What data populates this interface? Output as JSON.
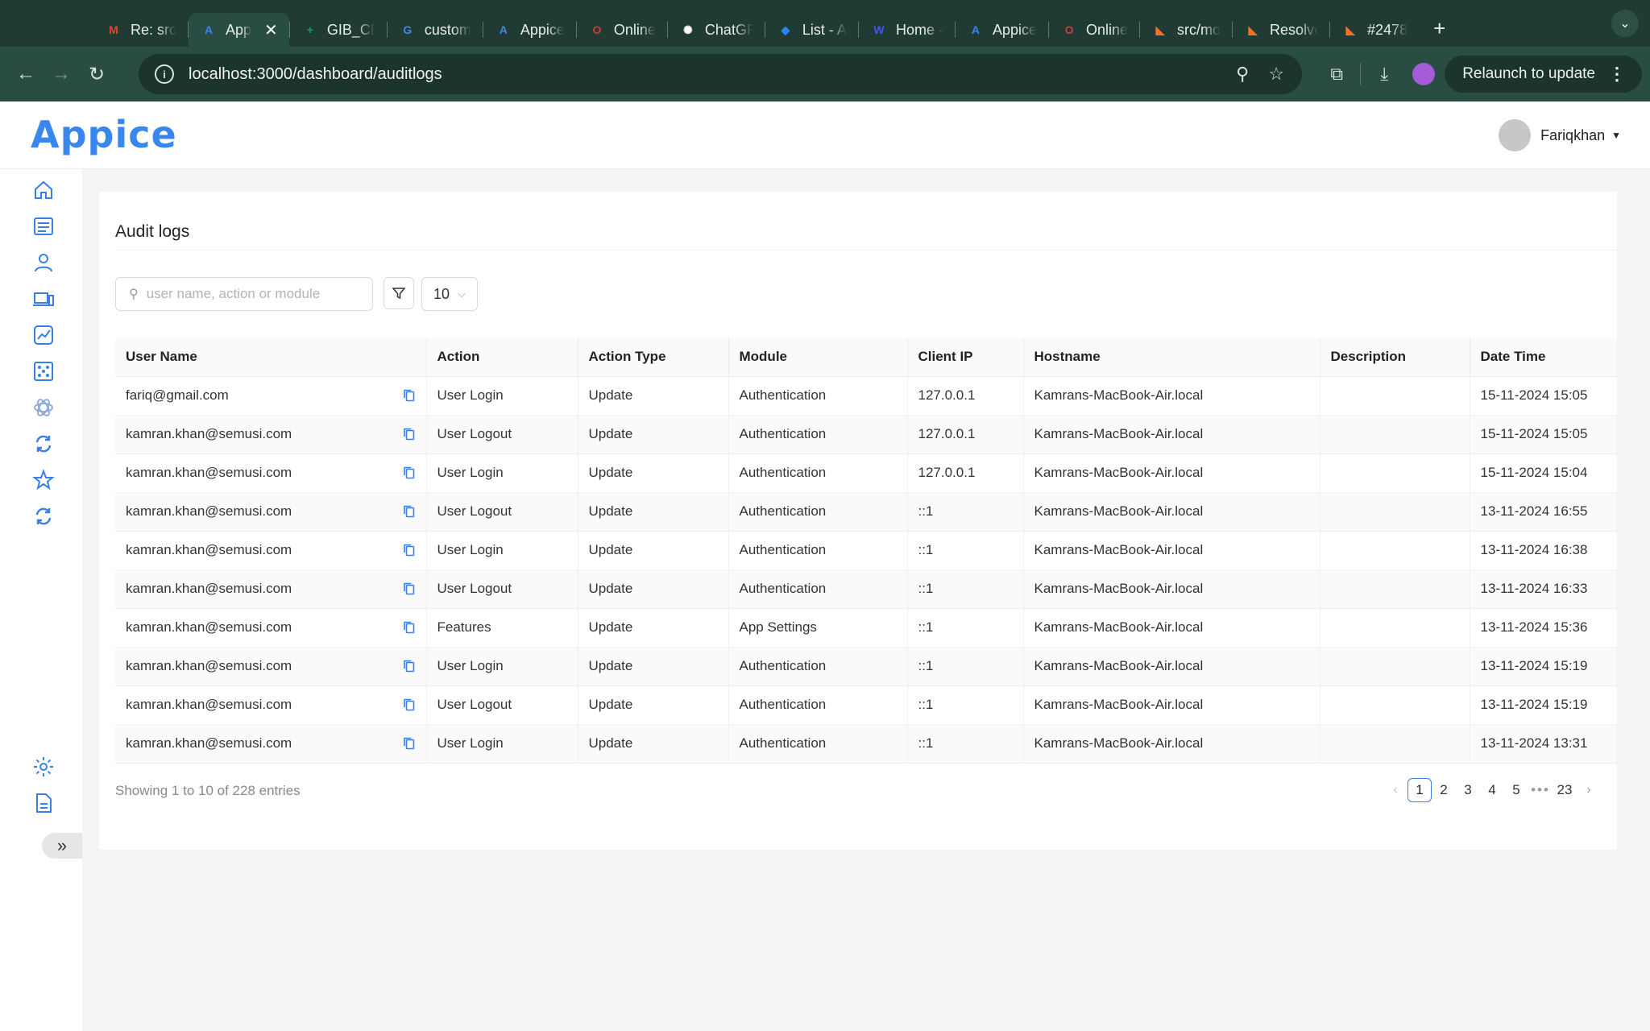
{
  "browser": {
    "tabs": [
      {
        "label": "Re: src",
        "icon": "gmail-icon",
        "color": "#ea4335"
      },
      {
        "label": "App",
        "icon": "appice-icon",
        "color": "#3a86ef",
        "active": true
      },
      {
        "label": "GIB_CD",
        "icon": "sheets-icon",
        "color": "#0f9d58"
      },
      {
        "label": "custom",
        "icon": "google-icon",
        "color": "#4285f4"
      },
      {
        "label": "Appice",
        "icon": "appice-icon",
        "color": "#3a86ef"
      },
      {
        "label": "Online",
        "icon": "opera-icon",
        "color": "#d13a3a"
      },
      {
        "label": "ChatGP",
        "icon": "chatgpt-icon",
        "color": "#ffffff"
      },
      {
        "label": "List - A",
        "icon": "jira-icon",
        "color": "#2684ff"
      },
      {
        "label": "Home -",
        "icon": "webflow-icon",
        "color": "#4353ff"
      },
      {
        "label": "Appice",
        "icon": "appice-icon",
        "color": "#3a86ef"
      },
      {
        "label": "Online",
        "icon": "opera-icon",
        "color": "#d13a3a"
      },
      {
        "label": "src/mo",
        "icon": "gitlab-icon",
        "color": "#fc6d26"
      },
      {
        "label": "Resolve",
        "icon": "gitlab-icon",
        "color": "#fc6d26"
      },
      {
        "label": "#2478",
        "icon": "gitlab-icon",
        "color": "#fc6d26"
      }
    ],
    "url": "localhost:3000/dashboard/auditlogs",
    "relaunch_label": "Relaunch to update"
  },
  "app": {
    "logo": "Appice",
    "user_name": "Fariqkhan"
  },
  "page": {
    "title": "Audit logs",
    "search_placeholder": "user name, action or module",
    "page_size": "10",
    "columns": [
      "User Name",
      "Action",
      "Action Type",
      "Module",
      "Client IP",
      "Hostname",
      "Description",
      "Date Time"
    ],
    "rows": [
      {
        "user": "fariq@gmail.com",
        "action": "User Login",
        "type": "Update",
        "module": "Authentication",
        "ip": "127.0.0.1",
        "host": "Kamrans-MacBook-Air.local",
        "desc": "",
        "time": "15-11-2024 15:05"
      },
      {
        "user": "kamran.khan@semusi.com",
        "action": "User Logout",
        "type": "Update",
        "module": "Authentication",
        "ip": "127.0.0.1",
        "host": "Kamrans-MacBook-Air.local",
        "desc": "",
        "time": "15-11-2024 15:05"
      },
      {
        "user": "kamran.khan@semusi.com",
        "action": "User Login",
        "type": "Update",
        "module": "Authentication",
        "ip": "127.0.0.1",
        "host": "Kamrans-MacBook-Air.local",
        "desc": "",
        "time": "15-11-2024 15:04"
      },
      {
        "user": "kamran.khan@semusi.com",
        "action": "User Logout",
        "type": "Update",
        "module": "Authentication",
        "ip": "::1",
        "host": "Kamrans-MacBook-Air.local",
        "desc": "",
        "time": "13-11-2024 16:55"
      },
      {
        "user": "kamran.khan@semusi.com",
        "action": "User Login",
        "type": "Update",
        "module": "Authentication",
        "ip": "::1",
        "host": "Kamrans-MacBook-Air.local",
        "desc": "",
        "time": "13-11-2024 16:38"
      },
      {
        "user": "kamran.khan@semusi.com",
        "action": "User Logout",
        "type": "Update",
        "module": "Authentication",
        "ip": "::1",
        "host": "Kamrans-MacBook-Air.local",
        "desc": "",
        "time": "13-11-2024 16:33"
      },
      {
        "user": "kamran.khan@semusi.com",
        "action": "Features",
        "type": "Update",
        "module": "App Settings",
        "ip": "::1",
        "host": "Kamrans-MacBook-Air.local",
        "desc": "",
        "time": "13-11-2024 15:36"
      },
      {
        "user": "kamran.khan@semusi.com",
        "action": "User Login",
        "type": "Update",
        "module": "Authentication",
        "ip": "::1",
        "host": "Kamrans-MacBook-Air.local",
        "desc": "",
        "time": "13-11-2024 15:19"
      },
      {
        "user": "kamran.khan@semusi.com",
        "action": "User Logout",
        "type": "Update",
        "module": "Authentication",
        "ip": "::1",
        "host": "Kamrans-MacBook-Air.local",
        "desc": "",
        "time": "13-11-2024 15:19"
      },
      {
        "user": "kamran.khan@semusi.com",
        "action": "User Login",
        "type": "Update",
        "module": "Authentication",
        "ip": "::1",
        "host": "Kamrans-MacBook-Air.local",
        "desc": "",
        "time": "13-11-2024 13:31"
      }
    ],
    "footer_info": "Showing 1 to 10 of 228 entries",
    "pagination": {
      "pages": [
        "1",
        "2",
        "3",
        "4",
        "5"
      ],
      "current": "1",
      "ellipsis": "•••",
      "last": "23"
    }
  },
  "colors": {
    "accent": "#3a7fe6",
    "browser_chrome": "#1f3b33"
  }
}
